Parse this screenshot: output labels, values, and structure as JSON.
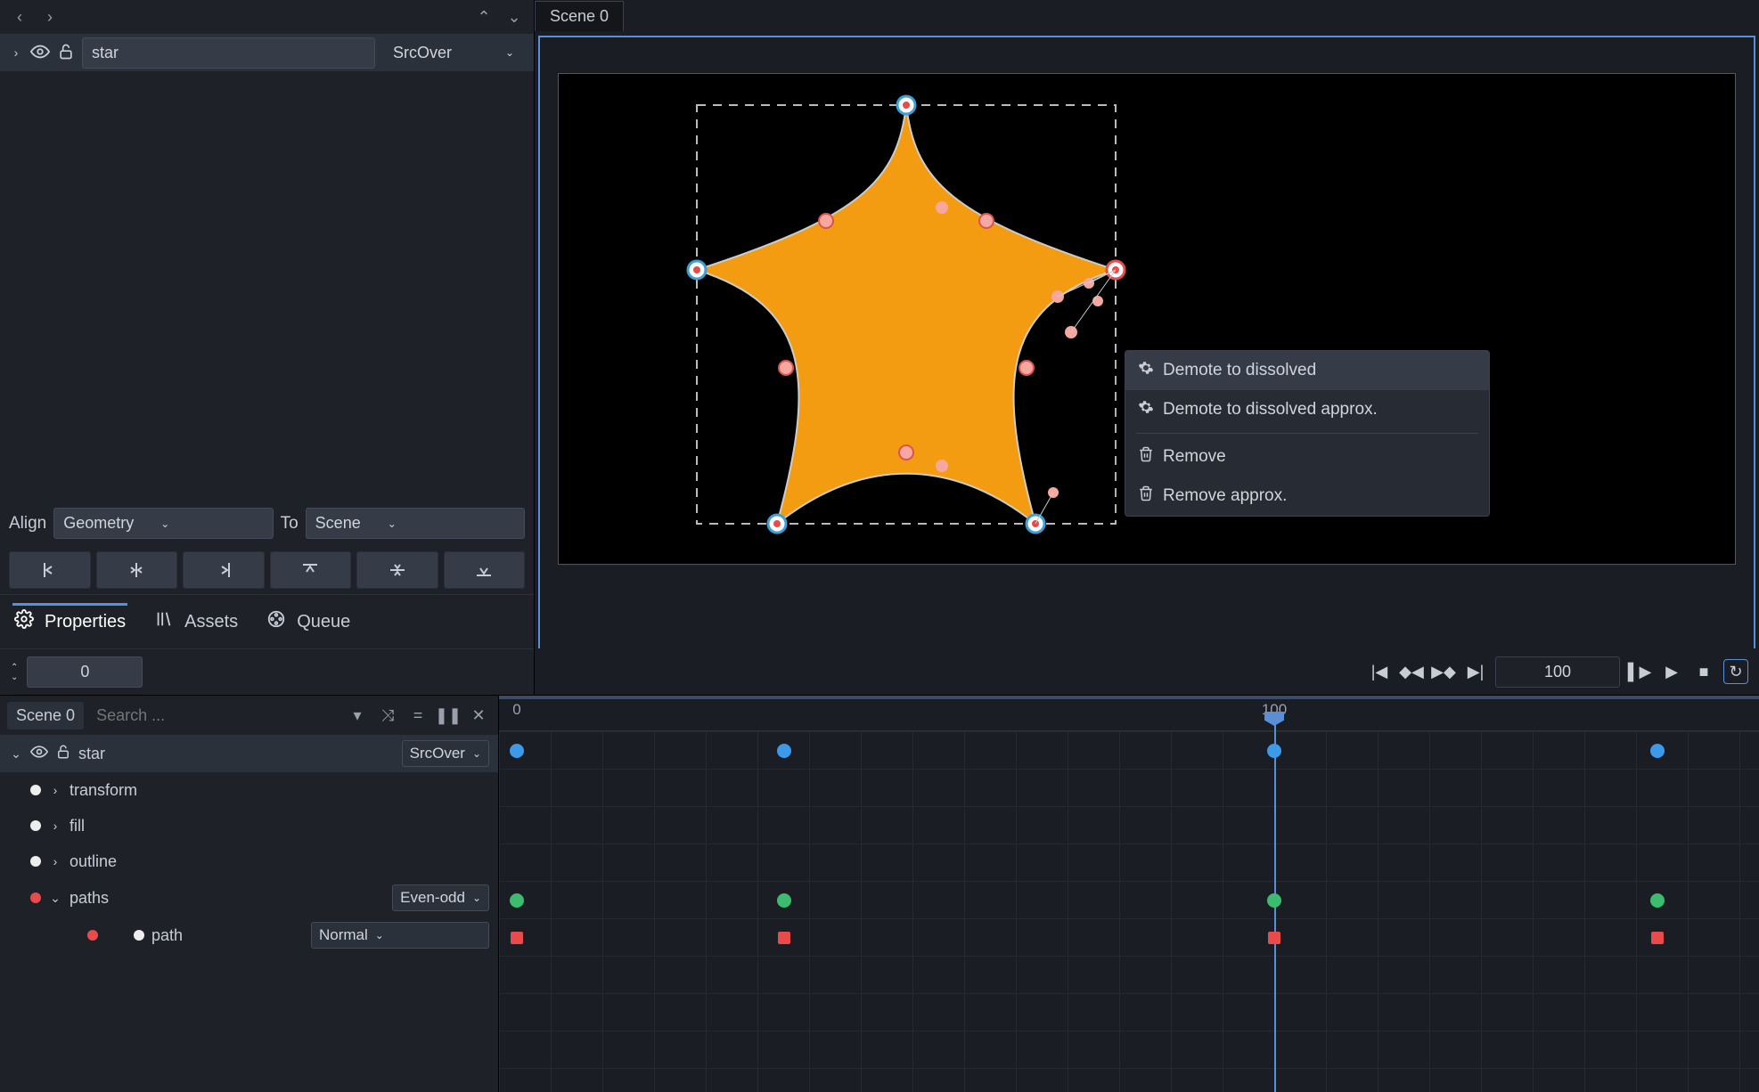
{
  "leftPanel": {
    "layerName": "star",
    "blendMode": "SrcOver",
    "alignLabel": "Align",
    "alignMode": "Geometry",
    "toLabel": "To",
    "toMode": "Scene",
    "tabs": {
      "properties": "Properties",
      "assets": "Assets",
      "queue": "Queue"
    },
    "numValue": "0"
  },
  "viewport": {
    "sceneTab": "Scene 0",
    "frameValue": "100",
    "contextMenu": {
      "demoteDissolved": "Demote to dissolved",
      "demoteDissolvedApprox": "Demote to dissolved approx.",
      "remove": "Remove",
      "removeApprox": "Remove approx."
    }
  },
  "tree": {
    "scene": "Scene 0",
    "searchPlaceholder": "Search ...",
    "star": "star",
    "starBlend": "SrcOver",
    "transform": "transform",
    "fill": "fill",
    "outline": "outline",
    "paths": "paths",
    "pathsRule": "Even-odd",
    "path": "path",
    "pathMode": "Normal"
  },
  "timeline": {
    "tick0": "0",
    "tick100": "100"
  }
}
